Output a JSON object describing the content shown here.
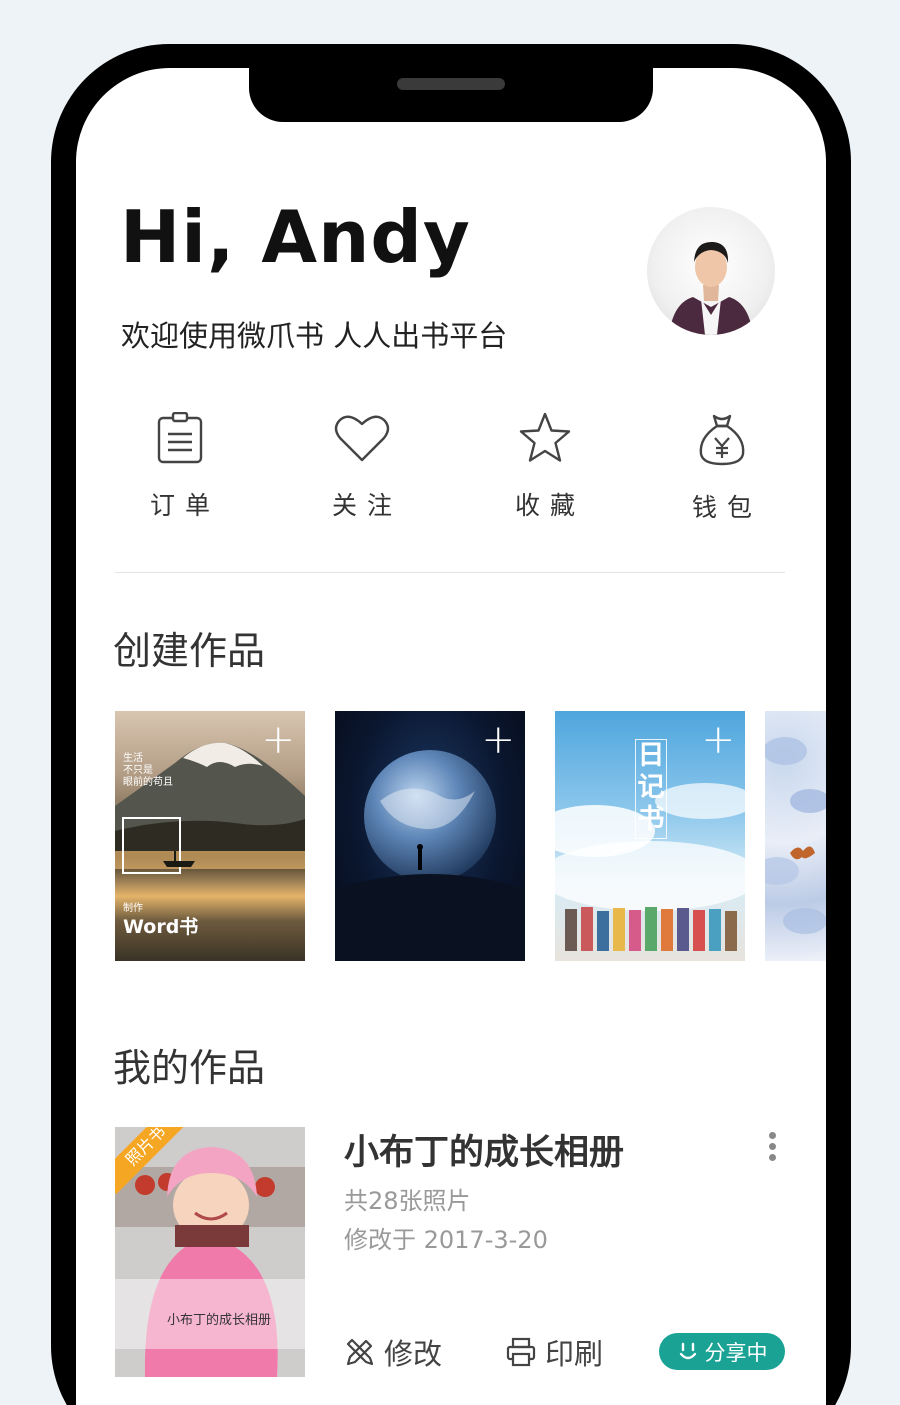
{
  "header": {
    "greeting": "Hi, Andy",
    "subtitle": "欢迎使用微爪书 人人出书平台"
  },
  "quick_actions": [
    {
      "label": "订单",
      "icon": "clipboard-icon"
    },
    {
      "label": "关注",
      "icon": "heart-icon"
    },
    {
      "label": "收藏",
      "icon": "star-icon"
    },
    {
      "label": "钱包",
      "icon": "money-bag-icon"
    }
  ],
  "create_section": {
    "title": "创建作品",
    "templates": [
      {
        "name": "mountain-lake",
        "caption": "生活\n不只是\n眼前的苟且",
        "badge_small": "制作",
        "badge_big": "Word书"
      },
      {
        "name": "earth"
      },
      {
        "name": "diary-book",
        "vertical_title": "日记书"
      },
      {
        "name": "floral"
      }
    ],
    "plus": "+"
  },
  "works_section": {
    "title": "我的作品",
    "items": [
      {
        "title": "小布丁的成长相册",
        "count": "共28张照片",
        "modified": "修改于 2017-3-20",
        "ribbon": "照片书",
        "cover_caption": "小布丁的成长相册",
        "edit_label": "修改",
        "print_label": "印刷",
        "share_label": "分享中"
      }
    ]
  },
  "colors": {
    "accent": "#1aa394",
    "ribbon": "#f5a623",
    "background": "#eef3f7"
  }
}
